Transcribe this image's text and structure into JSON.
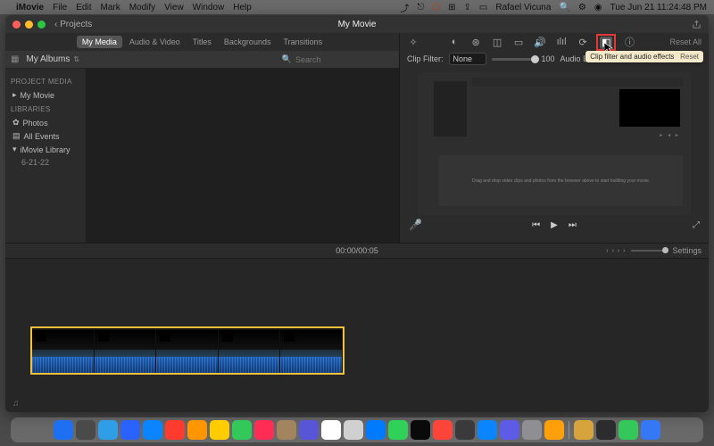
{
  "menubar": {
    "app": "iMovie",
    "items": [
      "File",
      "Edit",
      "Mark",
      "Modify",
      "View",
      "Window",
      "Help"
    ],
    "user": "Rafael Vicuna",
    "datetime": "Tue Jun 21  11:24:48 PM"
  },
  "window": {
    "back_label": "Projects",
    "title": "My Movie",
    "tabs": [
      "My Media",
      "Audio & Video",
      "Titles",
      "Backgrounds",
      "Transitions"
    ],
    "active_tab": 0,
    "albums_label": "My Albums",
    "search_placeholder": "Search"
  },
  "sidebar": {
    "section1": "PROJECT MEDIA",
    "item1": "My Movie",
    "section2": "LIBRARIES",
    "item_photos": "Photos",
    "item_events": "All Events",
    "item_lib": "iMovie Library",
    "item_date": "6-21-22"
  },
  "inspector": {
    "reset_all": "Reset All",
    "clip_filter_label": "Clip Filter:",
    "clip_filter_value": "None",
    "filter_amount": "100",
    "audio_label": "Audio E",
    "tooltip": "Clip filter and audio effects",
    "reset": "Reset"
  },
  "preview": {
    "placeholder": "Drag and drop video clips and photos from the browser above to start building your movie."
  },
  "timecode": {
    "current": "00:00",
    "sep": " / ",
    "total": "00:05",
    "settings": "Settings"
  },
  "dock_colors": [
    "#1e6ff2",
    "#4a4a4a",
    "#2f9ee6",
    "#2962ff",
    "#0a84ff",
    "#ff3b30",
    "#ff9500",
    "#ffcc00",
    "#34c759",
    "#ff2d55",
    "#a2845e",
    "#5856d6",
    "#ffffff",
    "#d0d0d0",
    "#007aff",
    "#30d158",
    "#0a0a0a",
    "#ff453a",
    "#3a3a3c",
    "#0a84ff",
    "#5e5ce6",
    "#8e8e93",
    "#ff9f0a",
    "#d7a33c",
    "#2c2c2e",
    "#34c759",
    "#3478f6"
  ]
}
